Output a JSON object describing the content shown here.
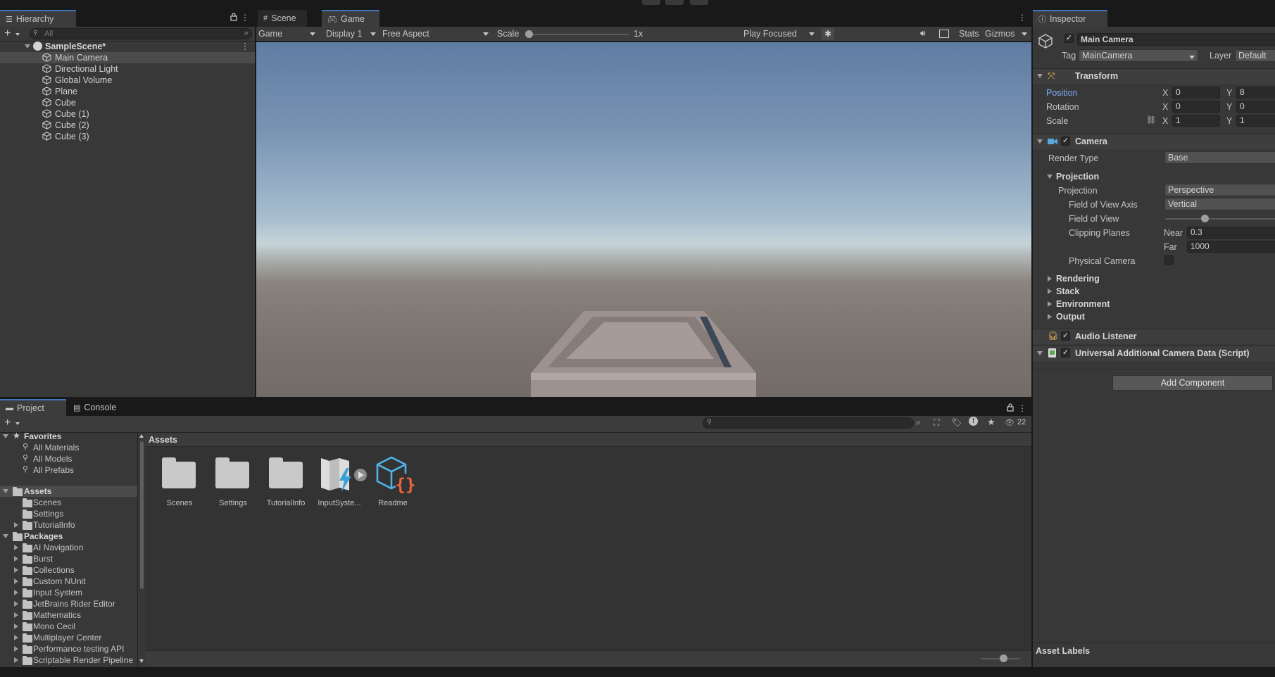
{
  "hierarchy": {
    "tab_label": "Hierarchy",
    "search_placeholder": "All",
    "scene_name": "SampleScene*",
    "items": [
      {
        "label": "Main Camera"
      },
      {
        "label": "Directional Light"
      },
      {
        "label": "Global Volume"
      },
      {
        "label": "Plane"
      },
      {
        "label": "Cube"
      },
      {
        "label": "Cube (1)"
      },
      {
        "label": "Cube (2)"
      },
      {
        "label": "Cube (3)"
      }
    ]
  },
  "center_tabs": {
    "scene": "Scene",
    "game": "Game"
  },
  "game_toolbar": {
    "mode": "Game",
    "display": "Display 1",
    "aspect": "Free Aspect",
    "scale_label": "Scale",
    "scale_value": "1x",
    "play_mode": "Play Focused",
    "stats": "Stats",
    "gizmos": "Gizmos",
    "scale_slider_fraction": 0.0
  },
  "inspector": {
    "tab_label": "Inspector",
    "object_name": "Main Camera",
    "object_enabled": true,
    "tag_label": "Tag",
    "tag_value": "MainCamera",
    "layer_label": "Layer",
    "layer_value": "Default",
    "transform": {
      "title": "Transform",
      "position_label": "Position",
      "rotation_label": "Rotation",
      "scale_label": "Scale",
      "axis_x": "X",
      "axis_y": "Y",
      "position": {
        "x": "0",
        "y": "8"
      },
      "rotation": {
        "x": "0",
        "y": "0"
      },
      "scale": {
        "x": "1",
        "y": "1"
      }
    },
    "camera": {
      "title": "Camera",
      "enabled": true,
      "render_type_label": "Render Type",
      "render_type_value": "Base",
      "projection_section": "Projection",
      "projection_label": "Projection",
      "projection_value": "Perspective",
      "fov_axis_label": "Field of View Axis",
      "fov_axis_value": "Vertical",
      "fov_label": "Field of View",
      "fov_slider_fraction": 0.35,
      "clipping_label": "Clipping Planes",
      "near_label": "Near",
      "near_value": "0.3",
      "far_label": "Far",
      "far_value": "1000",
      "physical_camera_label": "Physical Camera",
      "sections": [
        "Rendering",
        "Stack",
        "Environment",
        "Output"
      ]
    },
    "audio_listener": {
      "title": "Audio Listener",
      "enabled": true
    },
    "urp_data": {
      "title": "Universal Additional Camera Data (Script)",
      "enabled": true
    },
    "add_component": "Add Component",
    "asset_labels": "Asset Labels"
  },
  "bottom_tabs": {
    "project": "Project",
    "console": "Console"
  },
  "project": {
    "hidden_count": "22",
    "favorites_label": "Favorites",
    "favorites": [
      "All Materials",
      "All Models",
      "All Prefabs"
    ],
    "assets_label": "Assets",
    "asset_folders": [
      {
        "label": "Scenes",
        "expandable": false
      },
      {
        "label": "Settings",
        "expandable": false
      },
      {
        "label": "TutorialInfo",
        "expandable": true
      }
    ],
    "packages_label": "Packages",
    "packages": [
      "AI Navigation",
      "Burst",
      "Collections",
      "Custom NUnit",
      "Input System",
      "JetBrains Rider Editor",
      "Mathematics",
      "Mono Cecil",
      "Multiplayer Center",
      "Performance testing API",
      "Scriptable Render Pipeline"
    ],
    "breadcrumb": "Assets",
    "grid_items": [
      "Scenes",
      "Settings",
      "TutorialInfo",
      "InputSyste...",
      "Readme"
    ]
  },
  "colors": {
    "accent_blue": "#3a79bb",
    "position_label_blue": "#7cacf8",
    "readme_orange": "#f0643c",
    "readme_blue": "#4fb3e8"
  }
}
